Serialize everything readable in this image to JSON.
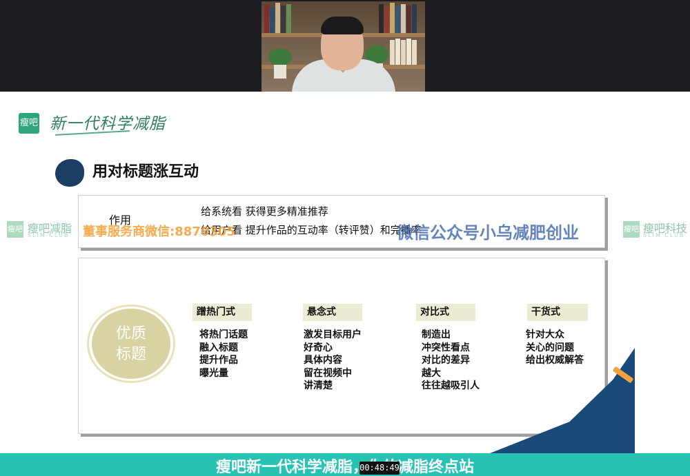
{
  "slide": {
    "logo_badge": "瘦吧",
    "logo_text": "新一代科学减脂",
    "section_title": "用对标题涨互动",
    "purpose_label": "作用",
    "purpose_line1": "给系统看   获得更多精准推荐",
    "purpose_line2": "给用户看   提升作品的互动率（转评赞）和完播率",
    "circle_label_1": "优质",
    "circle_label_2": "标题",
    "categories": [
      {
        "tag": "蹭热门式",
        "items": [
          "将热门话题",
          "融入标题",
          "提升作品",
          "曝光量"
        ]
      },
      {
        "tag": "悬念式",
        "items": [
          "激发目标用户",
          "好奇心",
          "具体内容",
          "留在视频中",
          "讲清楚"
        ]
      },
      {
        "tag": "对比式",
        "items": [
          "制造出",
          "冲突性看点",
          "对比的差异",
          "越大",
          "往往越吸引人"
        ]
      },
      {
        "tag": "干货式",
        "items": [
          "针对大众",
          "关心的问题",
          "给出权威解答"
        ]
      }
    ]
  },
  "watermarks": {
    "left_badge": "瘦吧",
    "left_text": "瘦吧减脂",
    "left_sub": "SLIM CLUB",
    "orange_text": "董事服务商微信:8870305",
    "blue_text": "微信公众号小乌减肥创业",
    "right_badge": "瘦吧",
    "right_text": "瘦吧科技",
    "right_sub": "SLIM CLUB"
  },
  "banner": {
    "text": "瘦吧新一代科学减脂，你的减脂终点站",
    "timestamp": "00:48:49"
  },
  "colors": {
    "accent_teal": "#26c3b5",
    "brand_green": "#2ea67a",
    "bullet_navy": "#1a3f63"
  }
}
